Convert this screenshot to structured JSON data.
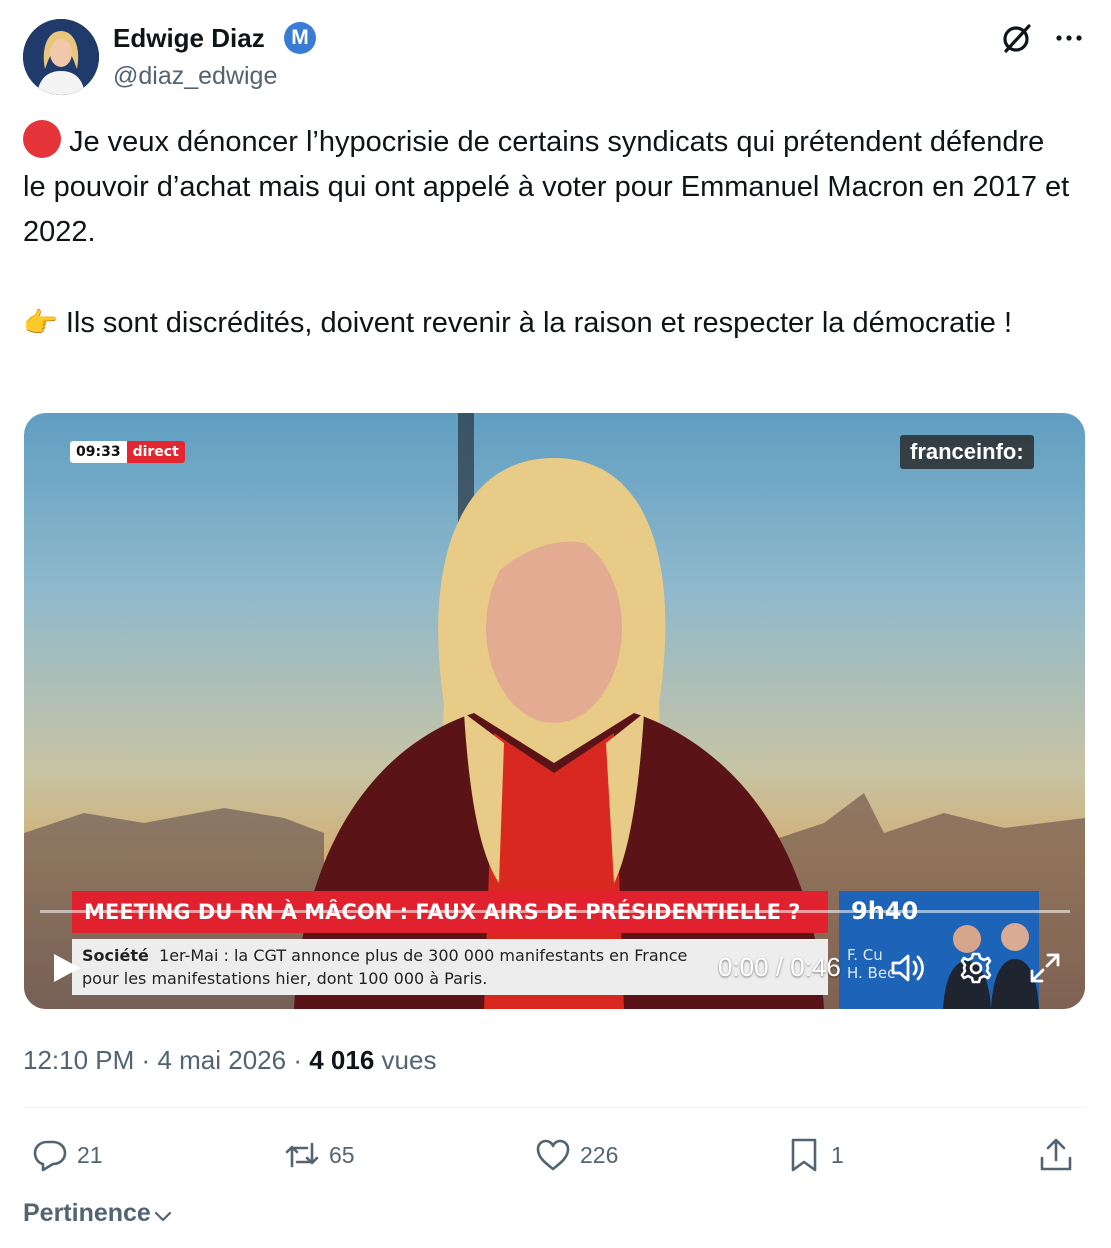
{
  "author": {
    "name": "Edwige Diaz",
    "badge_letter": "M",
    "handle": "@diaz_edwige",
    "avatar_icon": "profile-photo"
  },
  "header_icons": [
    "grok-icon",
    "more-icon"
  ],
  "tweet": {
    "paragraph1": "Je veux dénoncer l’hypocrisie de certains syndicats qui prétendent défendre le pouvoir d’achat mais qui ont appelé à voter pour Emmanuel Macron en 2017 et 2022.",
    "paragraph1_icon": "red-circle-icon",
    "paragraph2_emoji": "👉",
    "paragraph2": "Ils sont discrédités, doivent revenir à la raison et respecter la démocratie !"
  },
  "video": {
    "clock": "09:33",
    "live_label": "direct",
    "channel": "franceinfo:",
    "headline": "MEETING DU RN À MÂCON : FAUX AIRS DE PRÉSIDENTIELLE ?",
    "ticker_category": "Société",
    "ticker_line1": "1er-Mai : la CGT annonce plus de 300 000 manifestants en France",
    "ticker_line2": "pour les manifestations hier, dont 100 000 à Paris.",
    "side_time": "9h40",
    "side_name1": "F. Cu",
    "side_name2": "H. Bec",
    "timecode": "0:00 / 0:46",
    "progress": 0
  },
  "meta": {
    "time": "12:10 PM",
    "sep": "·",
    "date": "4 mai 2026",
    "views_count": "4 016",
    "views_label": "vues"
  },
  "actions": {
    "replies": "21",
    "reposts": "65",
    "likes": "226",
    "bookmarks": "1"
  },
  "sort_label": "Pertinence",
  "colors": {
    "text": "#0f1419",
    "secondary": "#536471",
    "badge": "#3a7bd5",
    "franceinfo_red": "#e1212d"
  }
}
